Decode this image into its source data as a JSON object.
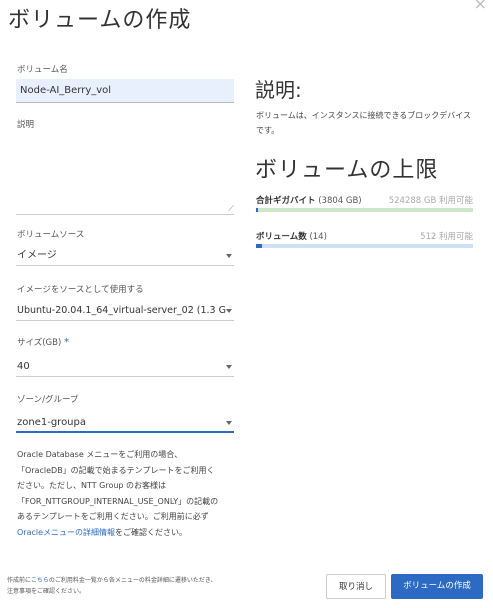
{
  "dialog": {
    "title": "ボリュームの作成",
    "close_label": "×"
  },
  "form": {
    "name_label": "ボリューム名",
    "name_value": "Node-AI_Berry_vol",
    "description_label": "説明",
    "description_value": "",
    "source_label": "ボリュームソース",
    "source_value": "イメージ",
    "image_label": "イメージをソースとして使用する",
    "image_value": "Ubuntu-20.04.1_64_virtual-server_02 (1.3 G",
    "size_label": "サイズ(GB)",
    "size_required": "*",
    "size_value": "40",
    "zone_label": "ゾーン/グループ",
    "zone_value": "zone1-groupa"
  },
  "notice": {
    "line1": "Oracle Database メニューをご利用の場合、",
    "line2": "「OracleDB」の記載で始まるテンプレートをご利用く",
    "line3": "ださい。ただし、NTT Group のお客様は",
    "line4": "「FOR_NTTGROUP_INTERNAL_USE_ONLY」の記載の",
    "line5": "あるテンプレートをご利用ください。ご利用前に必ず",
    "link_text": "Oracleメニューの詳細情報",
    "line6_suffix": "をご確認ください。"
  },
  "sidebar": {
    "description_heading": "説明:",
    "description_text": "ボリュームは、インスタンスに接続できるブロックデバイスです。",
    "limits_heading": "ボリュームの上限",
    "quotas": [
      {
        "name": "合計ギガバイト",
        "count": "(3804 GB)",
        "available": "524288 GB 利用可能",
        "used_fraction": 0.0073
      },
      {
        "name": "ボリューム数",
        "count": "(14)",
        "available": "512 利用可能",
        "used_fraction": 0.027
      }
    ]
  },
  "footer": {
    "note_prefix": "作成前に",
    "note_link": "こちら",
    "note_mid": "のご利用料金一覧から各メニューの料金詳細に遷移いただき、",
    "note_line2": "注意事項をご確認ください。",
    "cancel_label": "取り消し",
    "create_label": "ボリュームの作成"
  },
  "colors": {
    "accent": "#2d6ac4",
    "input_fill": "#e8f0fe",
    "quota_bar_green": "#cde6c8"
  }
}
